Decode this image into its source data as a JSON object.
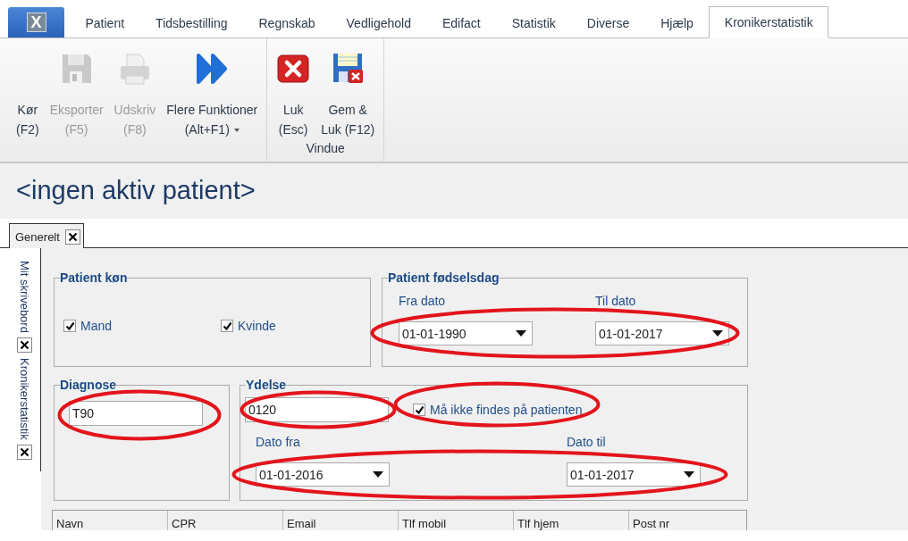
{
  "app_button": {
    "label": "X"
  },
  "ribbon_tabs": [
    {
      "label": "Patient",
      "selected": false
    },
    {
      "label": "Tidsbestilling",
      "selected": false
    },
    {
      "label": "Regnskab",
      "selected": false
    },
    {
      "label": "Vedligehold",
      "selected": false
    },
    {
      "label": "Edifact",
      "selected": false
    },
    {
      "label": "Statistik",
      "selected": false
    },
    {
      "label": "Diverse",
      "selected": false
    },
    {
      "label": "Hjælp",
      "selected": false
    },
    {
      "label": "Kronikerstatistik",
      "selected": true
    }
  ],
  "ribbon_groups": [
    {
      "buttons": [
        {
          "kind": "text",
          "lines": [
            "Kør",
            "(F2)"
          ],
          "disabled": false,
          "dropdown": false
        },
        {
          "kind": "save",
          "lines": [
            "Eksporter",
            "(F5)"
          ],
          "disabled": true,
          "dropdown": false
        },
        {
          "kind": "print",
          "lines": [
            "Udskriv",
            "(F8)"
          ],
          "disabled": true,
          "dropdown": false
        },
        {
          "kind": "forward",
          "lines": [
            "Flere Funktioner",
            "(Alt+F1)"
          ],
          "disabled": false,
          "dropdown": true
        }
      ]
    },
    {
      "label": "Vindue",
      "buttons": [
        {
          "kind": "close",
          "lines": [
            "Luk",
            "(Esc)"
          ],
          "disabled": false,
          "dropdown": false
        },
        {
          "kind": "save-close",
          "lines": [
            "Gem &",
            "Luk (F12)"
          ],
          "disabled": false,
          "dropdown": false
        }
      ]
    }
  ],
  "page_title": "<ingen aktiv patient>",
  "document_tabs": [
    {
      "label": "Generelt",
      "selected": true
    }
  ],
  "side_tabs": [
    {
      "label": "Mit skrivebord"
    },
    {
      "label": "Kronikerstatistik"
    }
  ],
  "patient_gender": {
    "title": "Patient køn",
    "options": [
      {
        "label": "Mand",
        "checked": true
      },
      {
        "label": "Kvinde",
        "checked": true
      }
    ]
  },
  "birthday": {
    "title": "Patient fødselsdag",
    "dates_circled": true,
    "from": {
      "label": "Fra dato",
      "value": "01-01-1990"
    },
    "to": {
      "label": "Til dato",
      "value": "01-01-2017"
    }
  },
  "diagnosis": {
    "title": "Diagnose",
    "value": "T90",
    "circled": true
  },
  "service": {
    "title": "Ydelse",
    "value": "0120",
    "circled": true,
    "exclude": {
      "label": "Må ikke findes på patienten",
      "checked": true,
      "circled": true
    },
    "dates_circled": true,
    "from": {
      "label": "Dato fra",
      "value": "01-01-2016"
    },
    "to": {
      "label": "Dato til",
      "value": "01-01-2017"
    }
  },
  "table": {
    "columns": [
      "Navn",
      "CPR",
      "Email",
      "Tlf mobil",
      "Tlf hjem",
      "Post nr"
    ]
  }
}
